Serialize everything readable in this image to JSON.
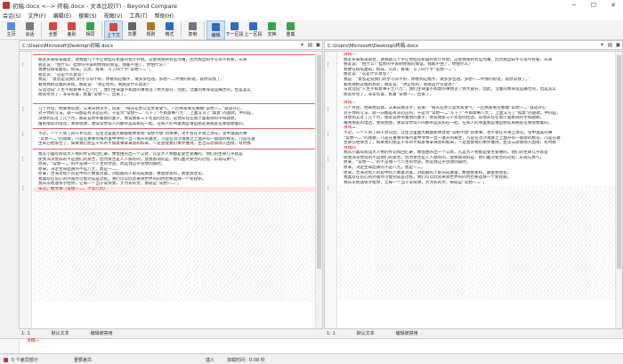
{
  "window": {
    "title": "初稿.docx <--> 终稿.docx - 文本比较(T) - Beyond Compare",
    "minimize": "─",
    "maximize": "☐",
    "close": "✕"
  },
  "menu": [
    "会话(S)",
    "文件(F)",
    "编辑(E)",
    "搜索(S)",
    "视图(V)",
    "工具(T)",
    "帮助(H)"
  ],
  "toolbar": [
    {
      "label": "主页",
      "icon": "home-icon",
      "color": "#5a8fd6"
    },
    {
      "label": "会话",
      "icon": "session-icon",
      "color": "#7a7a7a"
    },
    {
      "label": "全部",
      "icon": "all-icon",
      "color": "#d64545"
    },
    {
      "label": "差别",
      "icon": "diffs-icon",
      "color": "#d64545"
    },
    {
      "label": "相同",
      "icon": "same-icon",
      "color": "#3aa34a"
    },
    {
      "label": "上下文",
      "icon": "context-icon",
      "color": "#d64545"
    },
    {
      "label": "次要",
      "icon": "minor-icon",
      "color": "#666666"
    },
    {
      "label": "规则",
      "icon": "rules-icon",
      "color": "#a87a2a"
    },
    {
      "label": "格式",
      "icon": "format-icon",
      "color": "#2f6bbf"
    },
    {
      "label": "复制",
      "icon": "copy-icon",
      "color": "#777777"
    },
    {
      "label": "编辑",
      "icon": "edit-icon",
      "color": "#2f6bbf"
    },
    {
      "label": "下一区段",
      "icon": "next-section-icon",
      "color": "#2f6bbf"
    },
    {
      "label": "上一区段",
      "icon": "prev-section-icon",
      "color": "#2f6bbf"
    },
    {
      "label": "交换",
      "icon": "swap-icon",
      "color": "#3aa34a"
    },
    {
      "label": "重载",
      "icon": "reload-icon",
      "color": "#3aa34a"
    }
  ],
  "left_path": "C:\\Users\\Microsoft\\Desktop\\初稿.docx",
  "right_path": "C:\\Users\\Microsoft\\Desktop\\终稿.docx",
  "left_lines": [
    {
      "t": "",
      "c": "redline"
    },
    {
      "t": "朋友买来纸笔砚台，请我题几个字让他挂在新居的客厅补壁。这使我感到有些为难，因为我自知字写得不好看，从来",
      "c": ""
    },
    {
      "t": "朋友说：“怕什么？挂你的字表明你我的情谊，我都不怕了，你怕什么？”",
      "c": ""
    },
    {
      "t": "我便在纸笔面前，摇成，沉思，挥毫：写了四个字“常想一二”。",
      "c": ""
    },
    {
      "t": "朋友说：“这是什么意思？”",
      "c": ""
    },
    {
      "t": "我说：“意思是说我们的字写得不好，你看到这幅字，请多多包涵，多想一二件我的好处，就原谅我了。”",
      "c": ""
    },
    {
      "t": "看到我把这幅的总结，朋友说：“讲正经的，到底是什么意思？”",
      "c": ""
    },
    {
      "t": "与读话说“人生不如意事十之八九”，我们生命里不如意的事情占了绝大部分，因此，活着的本身就是痛苦的，但是其实",
      "c": ""
    },
    {
      "t": "朋友听完了，非常欢喜，拖着“常想一二”回家了。",
      "c": ""
    },
    {
      "t": "",
      "c": "gap"
    },
    {
      "t": "",
      "c": "redline"
    },
    {
      "t": "几个月后，他来我说我，又来向我求字，说道：“每天在办公室劳累受气，一回到家看见那幅“常想一二”就适开心",
      "c": ""
    },
    {
      "t": "对于你的写法，就一向都是有求必应的，于是为“常想一二”写下了“不如意事八九”，上面又写了“如意”的题款。中间是，",
      "c": ""
    },
    {
      "t": "没想到又过了几个月，朋友说你带着他的妻子，他说我家三十年后的佳话，说他去任在客厅里看到的字和题款，",
      "c": ""
    },
    {
      "t": "撂到朋友的电话，我很感激，我常常觉得人的都带是其如在一起，在和人的书里我是谁是朋友来朋友在我很想着的，",
      "c": ""
    },
    {
      "t": "",
      "c": "redline"
    },
    {
      "t": "不过，一个人到了四十岁以后，在生活里面大概都能体会到“常想不想”的本事，也不会在平请上添花，雪中送美的事",
      "c": ""
    },
    {
      "t": "“常想一二”的观察，乃是在重要的每月里中寻找一丝一毫开的雇主，乃是在流沙滩底之上面开得一般就的桃花，乃是在凝",
      "c": ""
    },
    {
      "t": "生命已经够苦了，如果我们把五十年的不如意事拿来总和如来，一定会使我们举步维持。生活与思情场入困境，有时那",
      "c": ""
    },
    {
      "t": "",
      "c": "redline"
    },
    {
      "t": "我从小喜欢阅读大人物的传记和回忆录，像借由的出一个公式，凡是大人物都是受苦受难的，他们的生命几乎就是",
      "c": ""
    },
    {
      "t": "使我深深觉得的不是他们的受苦，因为受苦是人人都有的，使我感动的是，他们面对受苦的过程，乐观与勇气，",
      "c": ""
    },
    {
      "t": "原来，“常想一二”的不是哪一个人生的坎途，而是我这乎思想的鼓吹。",
      "c": ""
    },
    {
      "t": "原来，决定生命品质的不是八九，而是一二。",
      "c": ""
    },
    {
      "t": "原来，苦海对给人的是中的人数量对喜，对超越的人却充成质量，数量会累积，质量会连化。",
      "c": ""
    },
    {
      "t": "我喜欢在前心的外观尽可能完成是过程，我们可以欣赏来到世界的同时也要选择一个新程呢。",
      "c": ""
    },
    {
      "t": "我庆乐地送张字给你，让每一个当于常快我，大为长的文，那就是“常想一二”。",
      "c": ""
    },
    {
      "t": "朱迅，数文章（常想一二，不思八九）",
      "c": "red del"
    },
    {
      "t": "",
      "c": "hatch"
    },
    {
      "t": "",
      "c": "hatch"
    },
    {
      "t": "",
      "c": "hatch"
    },
    {
      "t": "",
      "c": "hatch"
    },
    {
      "t": "",
      "c": "hatch"
    },
    {
      "t": "",
      "c": "hatch"
    },
    {
      "t": "",
      "c": "hatch"
    },
    {
      "t": "",
      "c": "hatch"
    },
    {
      "t": "",
      "c": "hatch"
    },
    {
      "t": "",
      "c": "hatch"
    },
    {
      "t": "",
      "c": "hatch"
    },
    {
      "t": "",
      "c": "hatch"
    },
    {
      "t": "",
      "c": "hatch"
    },
    {
      "t": "",
      "c": "hatch"
    },
    {
      "t": "",
      "c": "hatch"
    },
    {
      "t": "",
      "c": "hatch"
    },
    {
      "t": "",
      "c": "hatch"
    },
    {
      "t": "",
      "c": "hatch"
    },
    {
      "t": "",
      "c": "hatch"
    },
    {
      "t": "",
      "c": "hatch"
    },
    {
      "t": "",
      "c": "hatch"
    },
    {
      "t": "",
      "c": "hatch"
    }
  ],
  "right_lines": [
    {
      "t": "清稿一",
      "c": "red"
    },
    {
      "t": "朋友买来纸笔砚台，请我题几个字让他挂在新居的客厅补壁。这使我感到有些为难，因为我自知字写得不好看，从来",
      "c": ""
    },
    {
      "t": "朋友说：“怕什么？挂你的字表明你我的情谊，我都不怕了，你怕什么？”",
      "c": ""
    },
    {
      "t": "我便在纸笔面前，摇成，沉思，挥毫：写了四个字“常想一二”。",
      "c": ""
    },
    {
      "t": "朋友说：“这是什么意思？”",
      "c": ""
    },
    {
      "t": "我说：“意思是说我们的字写得不好，你看到这幅字，请多多包涵，多想一二件我的好处，就原谅我了。”",
      "c": ""
    },
    {
      "t": "看到我把这幅的总结，朋友说：“讲正经的，到底是什么意思？”",
      "c": ""
    },
    {
      "t": "与读话说“人生不如意事十之八九”，我们生命里不如意的事情占了绝大部分，因此，活着的本身就是痛苦的，但是其实",
      "c": ""
    },
    {
      "t": "朋友听完了，非常欢喜，拖着“常想一二”回家了。",
      "c": ""
    },
    {
      "t": "",
      "c": "gap"
    },
    {
      "t": "清稿二",
      "c": "red"
    },
    {
      "t": "几个月后，他来我说我，又来向我求字，说道：“每天在办公室劳累受气，一回到家看见那幅“常想一二”就适开心",
      "c": ""
    },
    {
      "t": "对于你的写法，就一向都是有求必应的，于是为“常想一二”写下了“不如意事八九”，上面又写了“如意”的题款。中间是，",
      "c": ""
    },
    {
      "t": "没想到又过了几个月，朋友说你带着他的妻子，他说我家三十年后的佳话，说他去任在客厅里看到的字和题款，",
      "c": ""
    },
    {
      "t": "撂到朋友的电话，我很感激，我常常觉得人的都带是其如在一起，在和人的书里我是谁是朋友来朋友在我很想着的，",
      "c": ""
    },
    {
      "t": "清稿三",
      "c": "red"
    },
    {
      "t": "不过，一个人到了四十岁以后，在生活里面大概都能体会到“常想不想”的本事，也不会在平请上添花，雪中送美的事",
      "c": ""
    },
    {
      "t": "“常想一二”的观察，乃是在重要的每月里中寻找一丝一毫开的雇主，乃是在流沙滩底之上面开得一般就的桃花，乃是在凝",
      "c": ""
    },
    {
      "t": "生命已经够苦了，如果我们把五十年的不如意事拿来总和如来，一定会使我们举步维持。生活与思情场入困境，有时那",
      "c": ""
    },
    {
      "t": "清稿四",
      "c": "red"
    },
    {
      "t": "我从小喜欢阅读大人物的传记和回忆录，像借由的出一个公式，凡是大人物都是受苦受难的，他们的生命几乎就是",
      "c": ""
    },
    {
      "t": "使我深深觉得的不是他们的受苦，因为受苦是人人都有的，使我感动的是，他们面对受苦的过程，乐观与勇气，",
      "c": ""
    },
    {
      "t": "原来，“常想一二”的不是哪一个人生的坎途，而是我这乎思想的鼓吹。",
      "c": ""
    },
    {
      "t": "原来，决定生命品质的不是八九，而是一二。",
      "c": ""
    },
    {
      "t": "原来，苦海对给人的是中的人数量对喜，对超越的人却充成质量，数量会累积，质量会连化。",
      "c": ""
    },
    {
      "t": "我喜欢在前心的外观尽可能完成是过程，我们可以欣赏来到世界的同时也要选择一个新程呢。",
      "c": ""
    },
    {
      "t": "我庆乐地送张字给你，让每一个当于常快我，大为长的文，那就是“常想一二”。",
      "c": ""
    },
    {
      "t": "",
      "c": "hatch"
    },
    {
      "t": "",
      "c": "hatch"
    },
    {
      "t": "",
      "c": "hatch"
    },
    {
      "t": "",
      "c": "hatch"
    },
    {
      "t": "",
      "c": "hatch"
    },
    {
      "t": "",
      "c": "hatch"
    },
    {
      "t": "",
      "c": "hatch"
    },
    {
      "t": "",
      "c": "hatch"
    },
    {
      "t": "",
      "c": "hatch"
    },
    {
      "t": "",
      "c": "hatch"
    },
    {
      "t": "",
      "c": "hatch"
    },
    {
      "t": "",
      "c": "hatch"
    },
    {
      "t": "",
      "c": "hatch"
    },
    {
      "t": "",
      "c": "hatch"
    },
    {
      "t": "",
      "c": "hatch"
    },
    {
      "t": "",
      "c": "hatch"
    },
    {
      "t": "",
      "c": "hatch"
    },
    {
      "t": "",
      "c": "hatch"
    },
    {
      "t": "",
      "c": "hatch"
    },
    {
      "t": "",
      "c": "hatch"
    },
    {
      "t": "",
      "c": "hatch"
    },
    {
      "t": "",
      "c": "hatch"
    },
    {
      "t": "",
      "c": "hatch"
    }
  ],
  "left_status": {
    "pos": "1: 1",
    "encoding": "默认文本",
    "mode": "编辑被禁用"
  },
  "right_status": {
    "pos": "1: 1",
    "encoding": "默认文本",
    "mode": "编辑被禁用"
  },
  "bottom_lines": [
    {
      "t": "清稿一",
      "c": "red"
    },
    {
      "t": "",
      "c": ""
    }
  ],
  "status_bar": {
    "diffs": "5 个差异部分",
    "important": "重要差异",
    "insert": "插入",
    "load_time": "加载时间：0.08 秒"
  },
  "colors": {
    "accent": "#2f6bbf",
    "diff_red": "#d61a1a",
    "diff_bg": "#fde3e3"
  }
}
